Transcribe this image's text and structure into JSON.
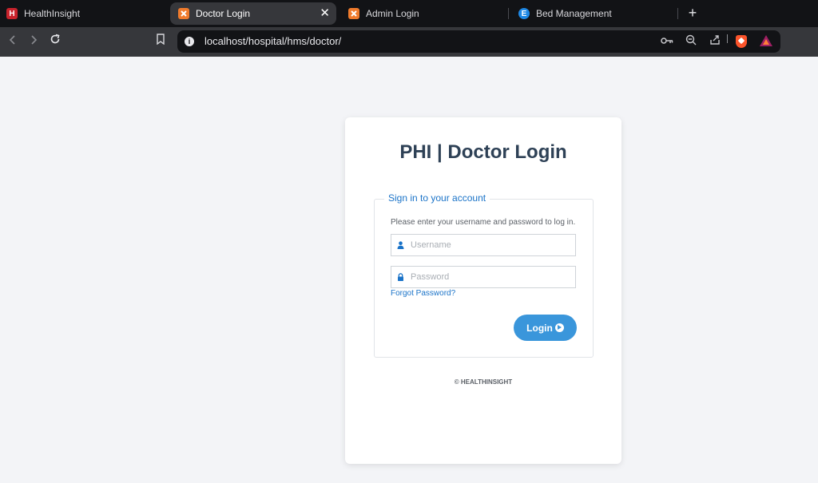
{
  "browser": {
    "tabs": [
      {
        "title": "HealthInsight",
        "favicon": "H",
        "favicon_color": "#c8232c",
        "active": false
      },
      {
        "title": "Doctor Login",
        "favicon": "xampp-icon",
        "favicon_color": "#f07b2c",
        "active": true
      },
      {
        "title": "Admin Login",
        "favicon": "xampp-icon",
        "favicon_color": "#f07b2c",
        "active": false
      },
      {
        "title": "Bed Management",
        "favicon": "E",
        "favicon_color": "#1e88e5",
        "active": false
      }
    ],
    "close_tab_label": "✕",
    "new_tab_label": "+",
    "url": "localhost/hospital/hms/doctor/"
  },
  "login": {
    "title": "PHI | Doctor Login",
    "legend": "Sign in to your account",
    "hint": "Please enter your username and password to log in.",
    "username_placeholder": "Username",
    "password_placeholder": "Password",
    "forgot_label": "Forgot Password?",
    "login_label": "Login",
    "copyright": "© HEALTHINSIGHT"
  },
  "colors": {
    "accent": "#3a96db",
    "link": "#1a73c8",
    "title": "#2e4156",
    "page_background": "#f3f4f7"
  }
}
